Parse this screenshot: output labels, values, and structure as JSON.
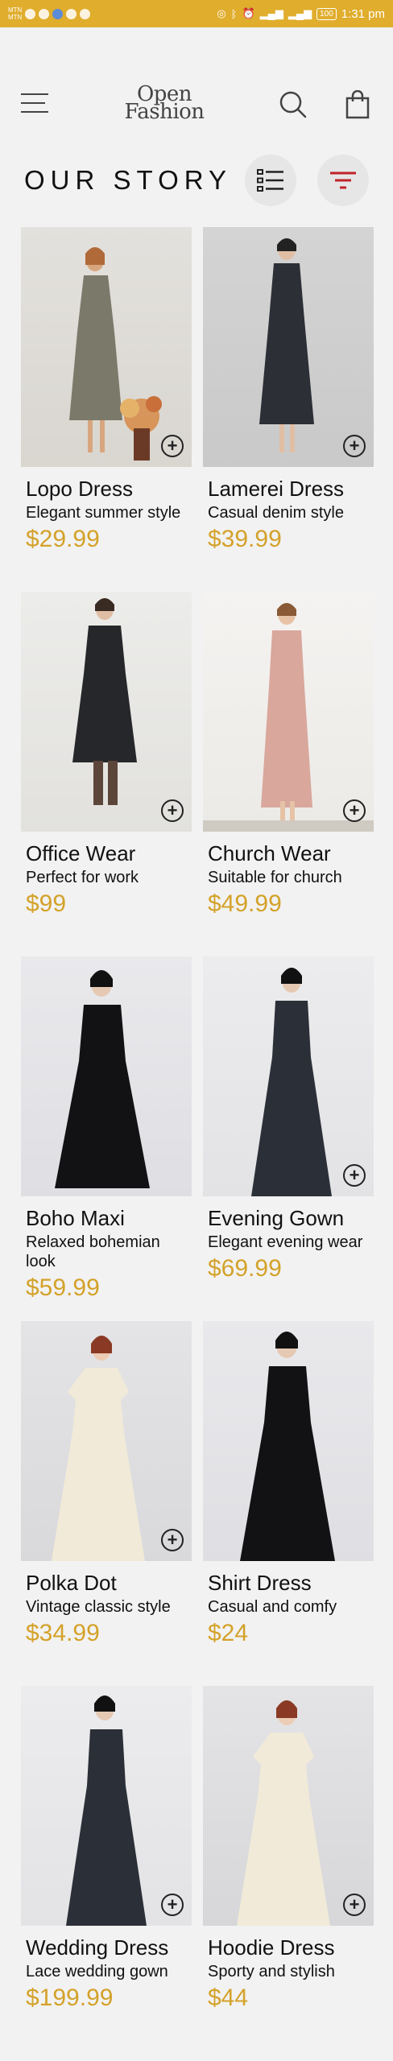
{
  "status_bar": {
    "carrier_1": "MTN",
    "carrier_2": "MTN",
    "battery": "100",
    "time": "1:31 pm"
  },
  "header": {
    "logo_line1": "Open",
    "logo_line2": "Fashion"
  },
  "page_title": "OUR STORY",
  "colors": {
    "accent": "#e0ad2c",
    "price": "#d4a22a",
    "filter": "#c0232a"
  },
  "products": [
    {
      "name": "Lopo Dress",
      "description": "Elegant summer style",
      "price": "$29.99"
    },
    {
      "name": "Lamerei Dress",
      "description": "Casual denim style",
      "price": "$39.99"
    },
    {
      "name": "Office Wear",
      "description": "Perfect for work",
      "price": "$99"
    },
    {
      "name": "Church Wear",
      "description": "Suitable for church",
      "price": "$49.99"
    },
    {
      "name": "Boho Maxi",
      "description": "Relaxed bohemian look",
      "price": "$59.99"
    },
    {
      "name": "Evening Gown",
      "description": "Elegant evening wear",
      "price": "$69.99"
    },
    {
      "name": "Polka Dot",
      "description": "Vintage classic style",
      "price": "$34.99"
    },
    {
      "name": "Shirt Dress",
      "description": "Casual and comfy",
      "price": "$24"
    },
    {
      "name": "Wedding Dress",
      "description": "Lace wedding gown",
      "price": "$199.99"
    },
    {
      "name": "Hoodie Dress",
      "description": "Sporty and stylish",
      "price": "$44"
    }
  ]
}
